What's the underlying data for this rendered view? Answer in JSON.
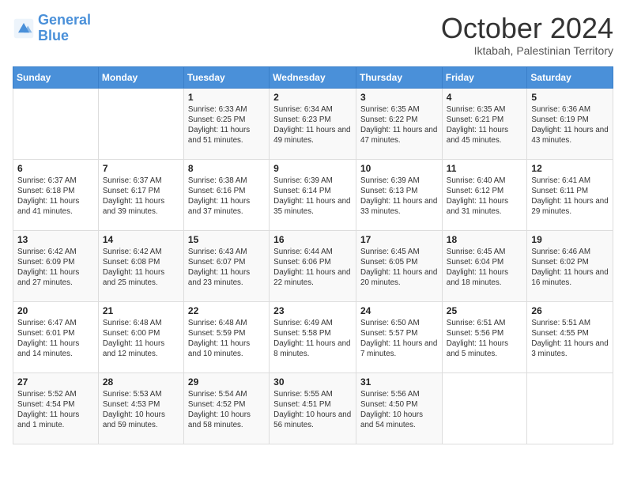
{
  "header": {
    "logo_line1": "General",
    "logo_line2": "Blue",
    "month_title": "October 2024",
    "location": "Iktabah, Palestinian Territory"
  },
  "weekdays": [
    "Sunday",
    "Monday",
    "Tuesday",
    "Wednesday",
    "Thursday",
    "Friday",
    "Saturday"
  ],
  "weeks": [
    [
      {
        "day": "",
        "info": ""
      },
      {
        "day": "",
        "info": ""
      },
      {
        "day": "1",
        "info": "Sunrise: 6:33 AM\nSunset: 6:25 PM\nDaylight: 11 hours and 51 minutes."
      },
      {
        "day": "2",
        "info": "Sunrise: 6:34 AM\nSunset: 6:23 PM\nDaylight: 11 hours and 49 minutes."
      },
      {
        "day": "3",
        "info": "Sunrise: 6:35 AM\nSunset: 6:22 PM\nDaylight: 11 hours and 47 minutes."
      },
      {
        "day": "4",
        "info": "Sunrise: 6:35 AM\nSunset: 6:21 PM\nDaylight: 11 hours and 45 minutes."
      },
      {
        "day": "5",
        "info": "Sunrise: 6:36 AM\nSunset: 6:19 PM\nDaylight: 11 hours and 43 minutes."
      }
    ],
    [
      {
        "day": "6",
        "info": "Sunrise: 6:37 AM\nSunset: 6:18 PM\nDaylight: 11 hours and 41 minutes."
      },
      {
        "day": "7",
        "info": "Sunrise: 6:37 AM\nSunset: 6:17 PM\nDaylight: 11 hours and 39 minutes."
      },
      {
        "day": "8",
        "info": "Sunrise: 6:38 AM\nSunset: 6:16 PM\nDaylight: 11 hours and 37 minutes."
      },
      {
        "day": "9",
        "info": "Sunrise: 6:39 AM\nSunset: 6:14 PM\nDaylight: 11 hours and 35 minutes."
      },
      {
        "day": "10",
        "info": "Sunrise: 6:39 AM\nSunset: 6:13 PM\nDaylight: 11 hours and 33 minutes."
      },
      {
        "day": "11",
        "info": "Sunrise: 6:40 AM\nSunset: 6:12 PM\nDaylight: 11 hours and 31 minutes."
      },
      {
        "day": "12",
        "info": "Sunrise: 6:41 AM\nSunset: 6:11 PM\nDaylight: 11 hours and 29 minutes."
      }
    ],
    [
      {
        "day": "13",
        "info": "Sunrise: 6:42 AM\nSunset: 6:09 PM\nDaylight: 11 hours and 27 minutes."
      },
      {
        "day": "14",
        "info": "Sunrise: 6:42 AM\nSunset: 6:08 PM\nDaylight: 11 hours and 25 minutes."
      },
      {
        "day": "15",
        "info": "Sunrise: 6:43 AM\nSunset: 6:07 PM\nDaylight: 11 hours and 23 minutes."
      },
      {
        "day": "16",
        "info": "Sunrise: 6:44 AM\nSunset: 6:06 PM\nDaylight: 11 hours and 22 minutes."
      },
      {
        "day": "17",
        "info": "Sunrise: 6:45 AM\nSunset: 6:05 PM\nDaylight: 11 hours and 20 minutes."
      },
      {
        "day": "18",
        "info": "Sunrise: 6:45 AM\nSunset: 6:04 PM\nDaylight: 11 hours and 18 minutes."
      },
      {
        "day": "19",
        "info": "Sunrise: 6:46 AM\nSunset: 6:02 PM\nDaylight: 11 hours and 16 minutes."
      }
    ],
    [
      {
        "day": "20",
        "info": "Sunrise: 6:47 AM\nSunset: 6:01 PM\nDaylight: 11 hours and 14 minutes."
      },
      {
        "day": "21",
        "info": "Sunrise: 6:48 AM\nSunset: 6:00 PM\nDaylight: 11 hours and 12 minutes."
      },
      {
        "day": "22",
        "info": "Sunrise: 6:48 AM\nSunset: 5:59 PM\nDaylight: 11 hours and 10 minutes."
      },
      {
        "day": "23",
        "info": "Sunrise: 6:49 AM\nSunset: 5:58 PM\nDaylight: 11 hours and 8 minutes."
      },
      {
        "day": "24",
        "info": "Sunrise: 6:50 AM\nSunset: 5:57 PM\nDaylight: 11 hours and 7 minutes."
      },
      {
        "day": "25",
        "info": "Sunrise: 6:51 AM\nSunset: 5:56 PM\nDaylight: 11 hours and 5 minutes."
      },
      {
        "day": "26",
        "info": "Sunrise: 5:51 AM\nSunset: 4:55 PM\nDaylight: 11 hours and 3 minutes."
      }
    ],
    [
      {
        "day": "27",
        "info": "Sunrise: 5:52 AM\nSunset: 4:54 PM\nDaylight: 11 hours and 1 minute."
      },
      {
        "day": "28",
        "info": "Sunrise: 5:53 AM\nSunset: 4:53 PM\nDaylight: 10 hours and 59 minutes."
      },
      {
        "day": "29",
        "info": "Sunrise: 5:54 AM\nSunset: 4:52 PM\nDaylight: 10 hours and 58 minutes."
      },
      {
        "day": "30",
        "info": "Sunrise: 5:55 AM\nSunset: 4:51 PM\nDaylight: 10 hours and 56 minutes."
      },
      {
        "day": "31",
        "info": "Sunrise: 5:56 AM\nSunset: 4:50 PM\nDaylight: 10 hours and 54 minutes."
      },
      {
        "day": "",
        "info": ""
      },
      {
        "day": "",
        "info": ""
      }
    ]
  ]
}
